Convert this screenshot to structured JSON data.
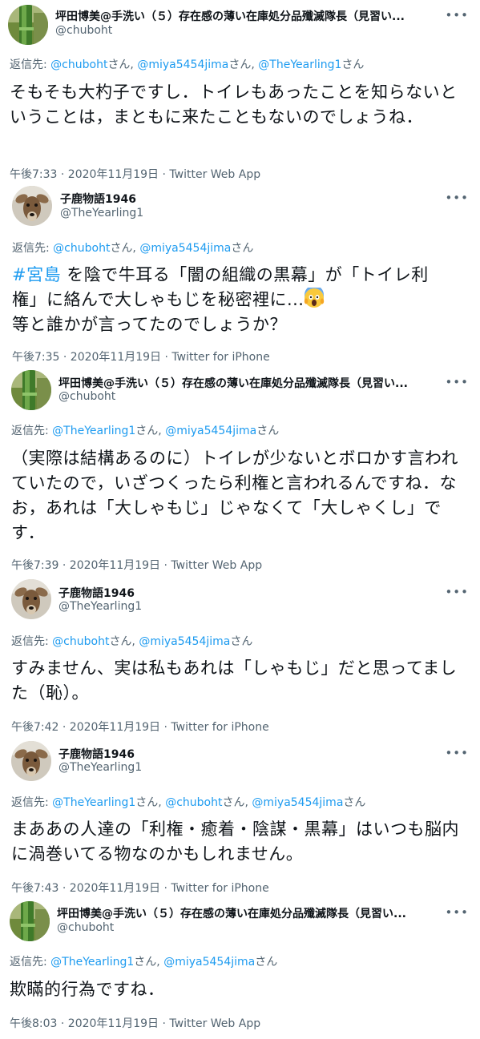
{
  "tweets": [
    {
      "name": "坪田博美@手洗い（５）存在感の薄い在庫処分品殲滅隊長（見習い...",
      "handle": "@chuboht",
      "more": "•••",
      "reply_prefix": "返信先: ",
      "mentions": [
        {
          "text": "@chuboht",
          "sep": "さん, "
        },
        {
          "text": "@miya5454jima",
          "sep": "さん, "
        },
        {
          "text": "@TheYearling1",
          "sep": "さん"
        }
      ],
      "body": "そもそも大杓子ですし．トイレもあったことを知らないということは，まともに来たこともないのでしょうね．",
      "time": "午後7:33 · 2020年11月19日 · ",
      "app": "Twitter Web App"
    },
    {
      "name": "子鹿物語1946",
      "handle": "@TheYearling1",
      "more": "•••",
      "reply_prefix": "返信先: ",
      "mentions": [
        {
          "text": "@chuboht",
          "sep": "さん, "
        },
        {
          "text": "@miya5454jima",
          "sep": "さん"
        }
      ],
      "hashtag": "#宮島",
      "body_line1": " を陰で牛耳る「闇の組織の黒幕」が「トイレ利",
      "body_line2": "権」に絡んで大しゃもじを秘密裡に...",
      "body_line3": "等と誰かが言ってたのでしょうか？",
      "time": "午後7:35 · 2020年11月19日 · ",
      "app": "Twitter for iPhone"
    },
    {
      "name": "坪田博美@手洗い（５）存在感の薄い在庫処分品殲滅隊長（見習い...",
      "handle": "@chuboht",
      "more": "•••",
      "reply_prefix": "返信先: ",
      "mentions": [
        {
          "text": "@TheYearling1",
          "sep": "さん, "
        },
        {
          "text": "@miya5454jima",
          "sep": "さん"
        }
      ],
      "body": "（実際は結構あるのに）トイレが少ないとボロかす言われていたので，いざつくったら利権と言われるんですね．なお，あれは「大しゃもじ」じゃなくて「大しゃくし」です．",
      "time": "午後7:39 · 2020年11月19日 · ",
      "app": "Twitter Web App"
    },
    {
      "name": "子鹿物語1946",
      "handle": "@TheYearling1",
      "more": "•••",
      "reply_prefix": "返信先: ",
      "mentions": [
        {
          "text": "@chuboht",
          "sep": "さん, "
        },
        {
          "text": "@miya5454jima",
          "sep": "さん"
        }
      ],
      "body": "すみません、実は私もあれは「しゃもじ」だと思ってました（恥）。",
      "time": "午後7:42 · 2020年11月19日 · ",
      "app": "Twitter for iPhone"
    },
    {
      "name": "子鹿物語1946",
      "handle": "@TheYearling1",
      "more": "•••",
      "reply_prefix": "返信先: ",
      "mentions": [
        {
          "text": "@TheYearling1",
          "sep": "さん, "
        },
        {
          "text": "@chuboht",
          "sep": "さん, "
        },
        {
          "text": "@miya5454jima",
          "sep": "さん"
        }
      ],
      "body": "まああの人達の「利権・癒着・陰謀・黒幕」はいつも脳内に渦巻いてる物なのかもしれません。",
      "time": "午後7:43 · 2020年11月19日 · ",
      "app": "Twitter for iPhone"
    },
    {
      "name": "坪田博美@手洗い（５）存在感の薄い在庫処分品殲滅隊長（見習い...",
      "handle": "@chuboht",
      "more": "•••",
      "reply_prefix": "返信先: ",
      "mentions": [
        {
          "text": "@TheYearling1",
          "sep": "さん, "
        },
        {
          "text": "@miya5454jima",
          "sep": "さん"
        }
      ],
      "body": "欺瞞的行為ですね．",
      "time": "午後8:03 · 2020年11月19日 · ",
      "app": "Twitter Web App"
    }
  ],
  "colors": {
    "text": "#0f1419",
    "muted": "#536471",
    "link": "#1d9bf0"
  },
  "icons": {
    "avatar_chuboht": "plant-stem-avatar",
    "avatar_yearling": "deer-avatar",
    "more": "more-options-icon",
    "emoji": "face-screaming-in-fear-emoji"
  }
}
